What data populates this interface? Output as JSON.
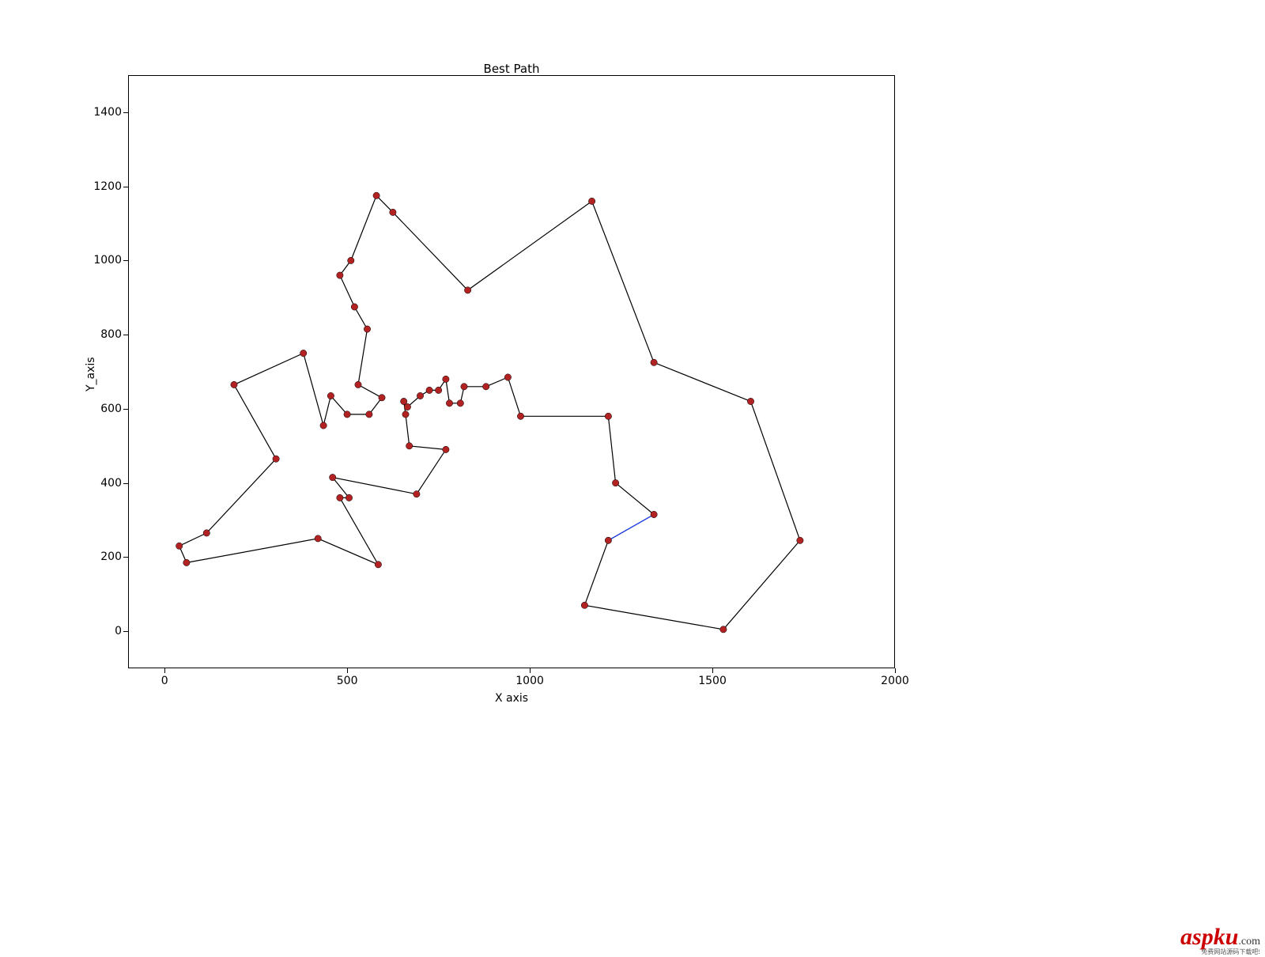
{
  "chart_data": {
    "type": "line",
    "title": "Best Path",
    "xlabel": "X axis",
    "ylabel": "Y_axis",
    "xlim": [
      -100,
      2000
    ],
    "ylim": [
      -100,
      1500
    ],
    "xticks": [
      0,
      500,
      1000,
      1500,
      2000
    ],
    "yticks": [
      0,
      200,
      400,
      600,
      800,
      1000,
      1200,
      1400
    ],
    "path": [
      [
        1340,
        315
      ],
      [
        1215,
        245
      ],
      [
        1150,
        70
      ],
      [
        1530,
        5
      ],
      [
        1740,
        245
      ],
      [
        1605,
        620
      ],
      [
        1340,
        725
      ],
      [
        1170,
        1160
      ],
      [
        830,
        920
      ],
      [
        625,
        1130
      ],
      [
        580,
        1175
      ],
      [
        510,
        1000
      ],
      [
        480,
        960
      ],
      [
        520,
        875
      ],
      [
        555,
        815
      ],
      [
        530,
        665
      ],
      [
        595,
        630
      ],
      [
        560,
        585
      ],
      [
        500,
        585
      ],
      [
        455,
        635
      ],
      [
        435,
        555
      ],
      [
        380,
        750
      ],
      [
        190,
        665
      ],
      [
        305,
        465
      ],
      [
        115,
        265
      ],
      [
        40,
        230
      ],
      [
        60,
        185
      ],
      [
        420,
        250
      ],
      [
        585,
        180
      ],
      [
        480,
        360
      ],
      [
        505,
        360
      ],
      [
        460,
        415
      ],
      [
        690,
        370
      ],
      [
        770,
        490
      ],
      [
        670,
        500
      ],
      [
        660,
        585
      ],
      [
        655,
        620
      ],
      [
        665,
        605
      ],
      [
        700,
        635
      ],
      [
        725,
        650
      ],
      [
        750,
        650
      ],
      [
        770,
        680
      ],
      [
        780,
        615
      ],
      [
        810,
        615
      ],
      [
        820,
        660
      ],
      [
        880,
        660
      ],
      [
        940,
        685
      ],
      [
        975,
        580
      ],
      [
        1215,
        580
      ],
      [
        1235,
        400
      ],
      [
        1340,
        315
      ]
    ],
    "blue_segment": [
      [
        1340,
        315
      ],
      [
        1215,
        245
      ]
    ],
    "colors": {
      "marker_face": "#b22222",
      "marker_edge": "#000000",
      "line_main": "#000000",
      "line_start": "#1f3fff"
    }
  },
  "layout": {
    "fig_w": 1600,
    "fig_h": 1210,
    "axes_left": 162,
    "axes_top": 95,
    "axes_w": 970,
    "axes_h": 750
  },
  "watermark": {
    "main": "aspku",
    "suffix": ".com",
    "sub": "免费网站源码下载吧!"
  }
}
